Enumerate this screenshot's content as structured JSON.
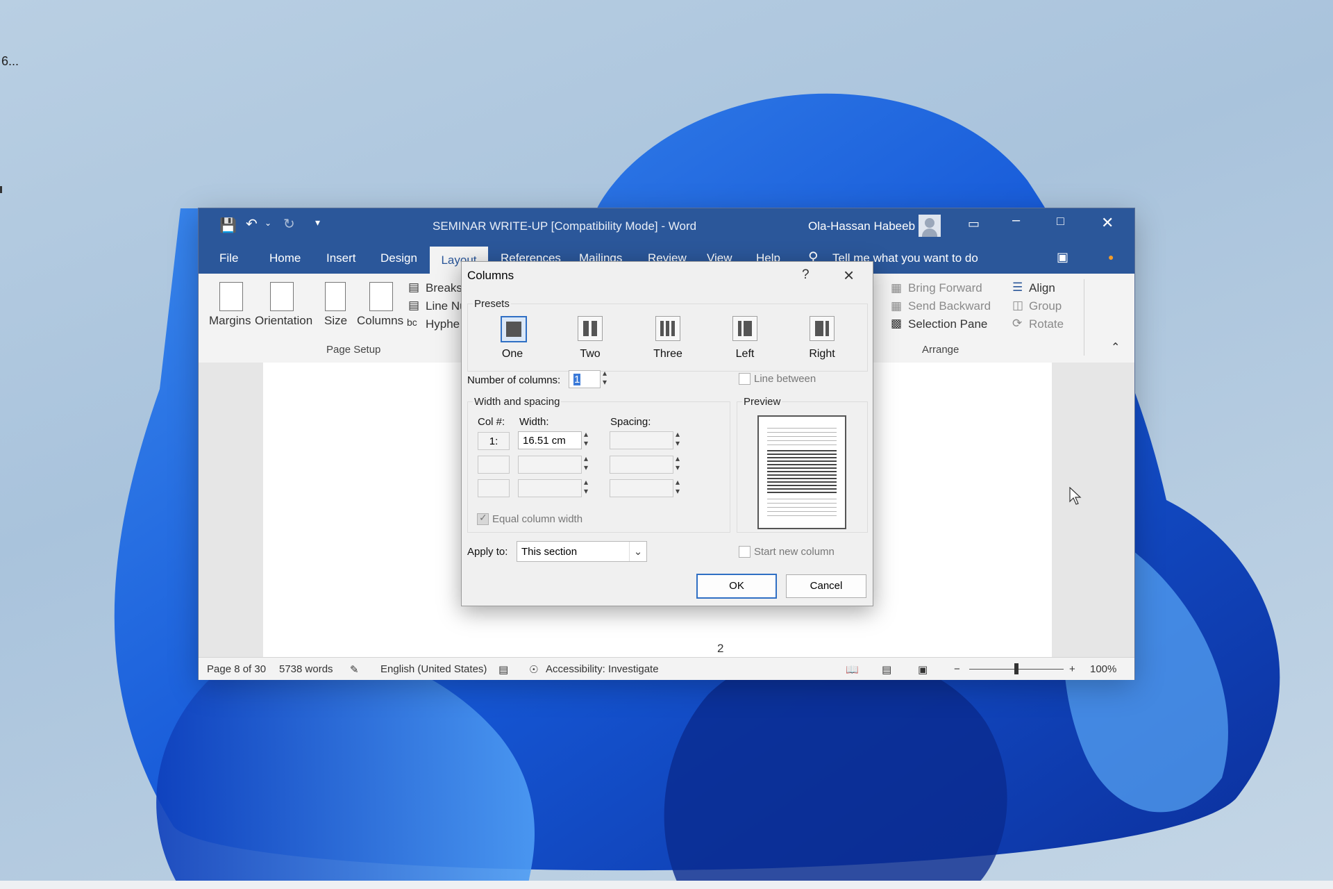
{
  "desktop": {
    "label": "6..."
  },
  "window": {
    "title": "SEMINAR WRITE-UP [Compatibility Mode]  -  Word",
    "user": "Ola-Hassan Habeeb",
    "tabs": [
      "File",
      "Home",
      "Insert",
      "Design",
      "Layout",
      "References",
      "Mailings",
      "Review",
      "View",
      "Help"
    ],
    "tell_me": "Tell me what you want to do"
  },
  "ribbon": {
    "page_setup": {
      "margins": "Margins",
      "orientation": "Orientation",
      "size": "Size",
      "columns": "Columns",
      "breaks": "Breaks",
      "line_numbers": "Line Nu",
      "hyphenation": "Hyphe",
      "group_label": "Page Setup"
    },
    "arrange": {
      "bring_forward": "Bring Forward",
      "send_backward": "Send Backward",
      "selection_pane": "Selection Pane",
      "align": "Align",
      "group": "Group",
      "rotate": "Rotate",
      "group_label": "Arrange"
    }
  },
  "document": {
    "page_number": "2"
  },
  "status": {
    "page": "Page 8 of 30",
    "words": "5738 words",
    "language": "English (United States)",
    "accessibility": "Accessibility: Investigate",
    "zoom": "100%"
  },
  "dialog": {
    "title": "Columns",
    "help": "?",
    "presets_label": "Presets",
    "presets": [
      "One",
      "Two",
      "Three",
      "Left",
      "Right"
    ],
    "selected_preset": "One",
    "num_columns_label": "Number of columns:",
    "num_columns_value": "1",
    "line_between": "Line between",
    "width_spacing_label": "Width and spacing",
    "col_header": "Col #:",
    "width_header": "Width:",
    "spacing_header": "Spacing:",
    "row1_col": "1:",
    "row1_width": "16.51 cm",
    "equal_width": "Equal column width",
    "preview_label": "Preview",
    "apply_to_label": "Apply to:",
    "apply_to_value": "This section",
    "start_new_column": "Start new column",
    "ok": "OK",
    "cancel": "Cancel"
  }
}
